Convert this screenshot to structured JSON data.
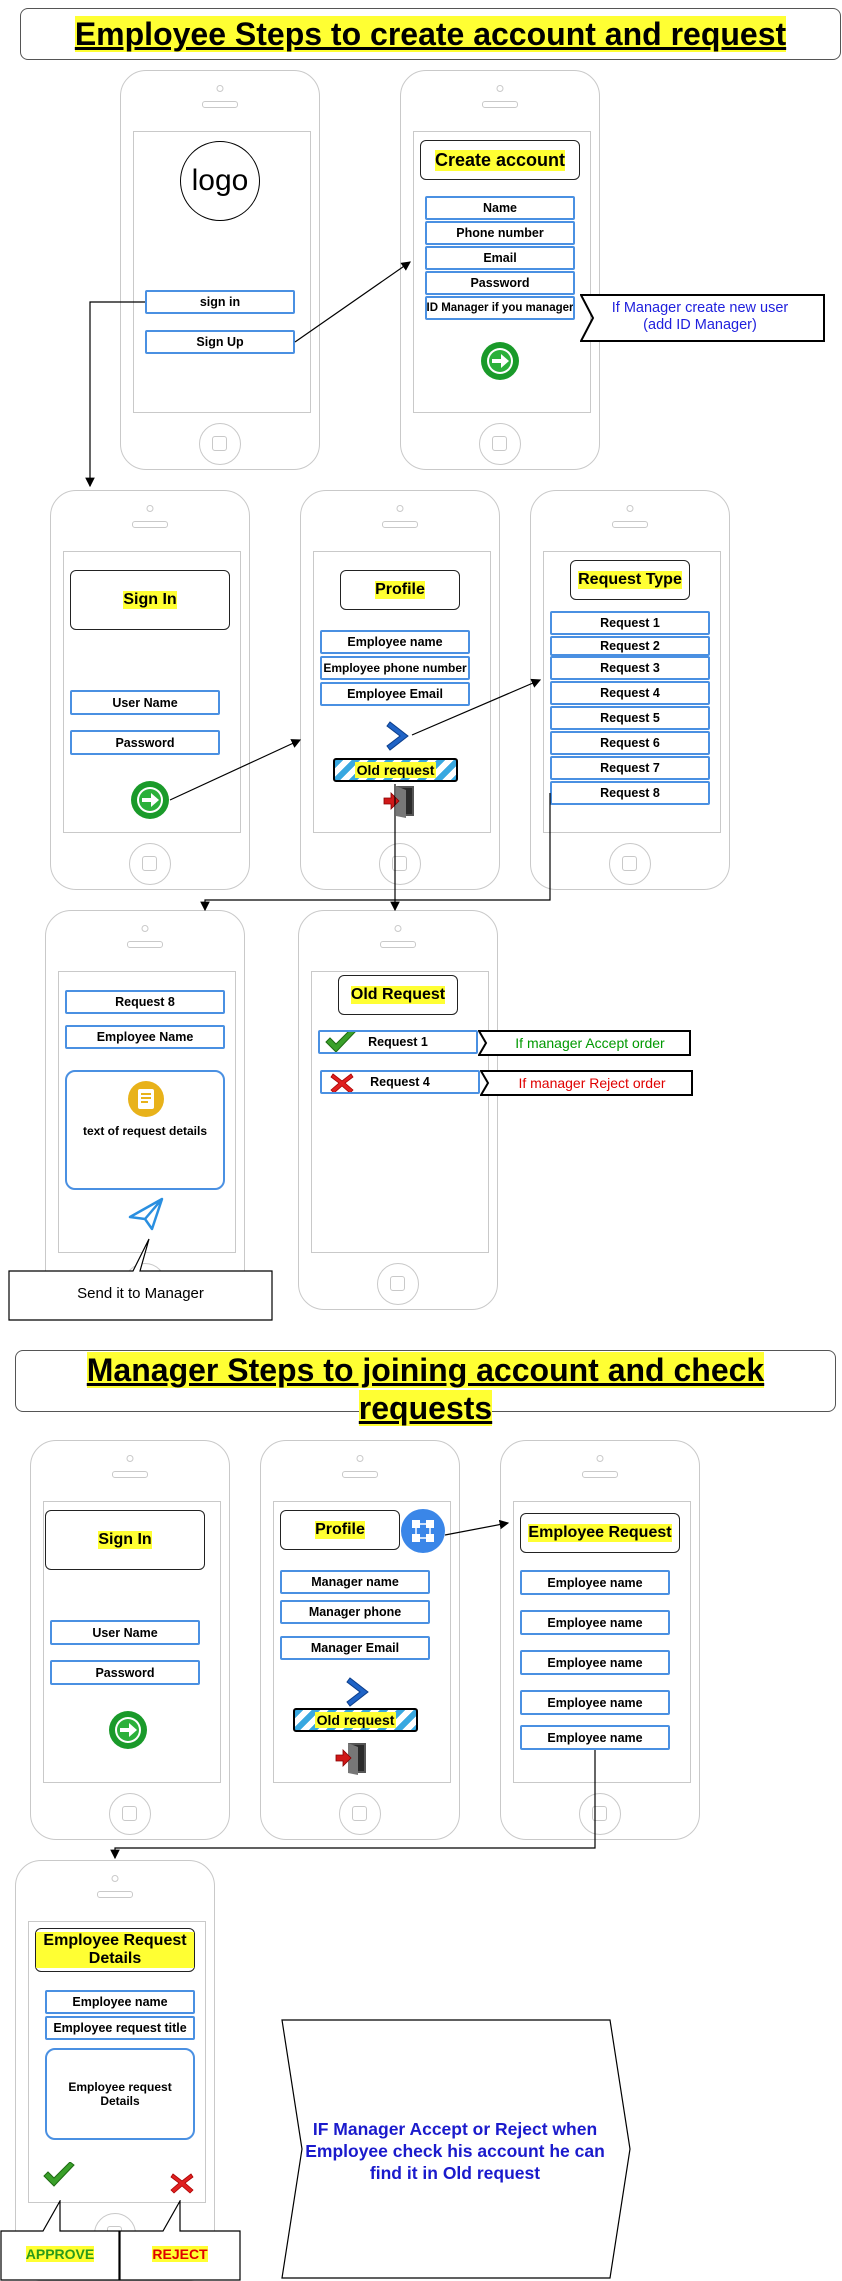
{
  "employee_section": {
    "title": "Employee Steps to create account and request",
    "logo_text": "logo",
    "signin_button": "sign in",
    "signup_button": "Sign Up",
    "create_account": {
      "title": "Create account",
      "fields": [
        "Name",
        "Phone number",
        "Email",
        "Password",
        "ID Manager if you manager"
      ],
      "callout": "If Manager create new user (add ID Manager)"
    },
    "sign_in": {
      "title": "Sign In",
      "fields": [
        "User Name",
        "Password"
      ]
    },
    "profile": {
      "title": "Profile",
      "fields": [
        "Employee name",
        "Employee phone number",
        "Employee Email"
      ],
      "old_request": "Old request"
    },
    "request_type": {
      "title": "Request Type",
      "items": [
        "Request 1",
        "Request 2",
        "Request 3",
        "Request 4",
        "Request 5",
        "Request 6",
        "Request 7",
        "Request 8"
      ]
    },
    "request_form": {
      "fields": [
        "Request 8",
        "Employee Name"
      ],
      "details": "text of request details",
      "callout": "Send it to Manager"
    },
    "old_request": {
      "title": "Old Request",
      "items": [
        {
          "label": "Request 1",
          "note": "If manager Accept order",
          "note_color": "#009900"
        },
        {
          "label": "Request 4",
          "note": "If manager Reject order",
          "note_color": "#e00000"
        }
      ]
    }
  },
  "manager_section": {
    "title": "Manager Steps to joining account and check requests",
    "sign_in": {
      "title": "Sign In",
      "fields": [
        "User Name",
        "Password"
      ]
    },
    "profile": {
      "title": "Profile",
      "fields": [
        "Manager name",
        "Manager phone",
        "Manager Email"
      ],
      "old_request": "Old request"
    },
    "employee_request": {
      "title": "Employee Request",
      "items": [
        "Employee name",
        "Employee name",
        "Employee name",
        "Employee name",
        "Employee name"
      ]
    },
    "request_details": {
      "title": "Employee Request Details",
      "fields": [
        "Employee name",
        "Employee request title"
      ],
      "details": "Employee request Details",
      "approve": "APPROVE",
      "reject": "REJECT"
    },
    "note": "IF Manager Accept or Reject when Employee check his account he can find it in Old request"
  },
  "colors": {
    "highlight": "#ffff33",
    "field_border": "#4a90e2",
    "phone_outline": "#c9c9c9",
    "go_button": "#1a9a2a",
    "note_blue": "#0000cc"
  },
  "icons": [
    "arrow-circle-icon",
    "chevron-right-icon",
    "exit-door-icon",
    "document-icon",
    "send-icon",
    "checkmark-icon",
    "cross-icon",
    "share-icon"
  ]
}
